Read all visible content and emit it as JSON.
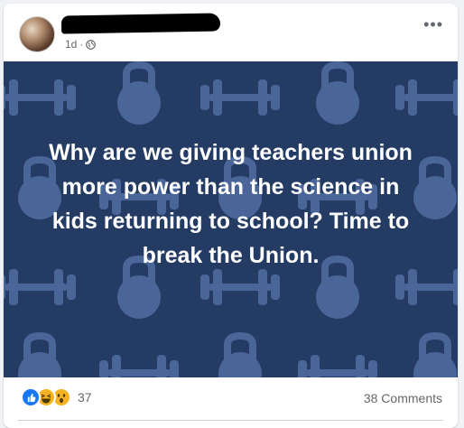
{
  "post": {
    "time": "1d",
    "separator": "·",
    "privacy_icon": "globe-icon",
    "more_label": "•••",
    "text": "Why are we giving teachers union more power than the science in kids returning to school? Time to break the Union."
  },
  "footer": {
    "reaction_icons": [
      "like-icon",
      "haha-icon",
      "wow-icon"
    ],
    "reaction_count": "37",
    "comments": "38 Comments"
  },
  "colors": {
    "media_background": "#243b64",
    "pattern": "#4a6597",
    "like": "#1877f2",
    "emoji": "#f7b125"
  }
}
